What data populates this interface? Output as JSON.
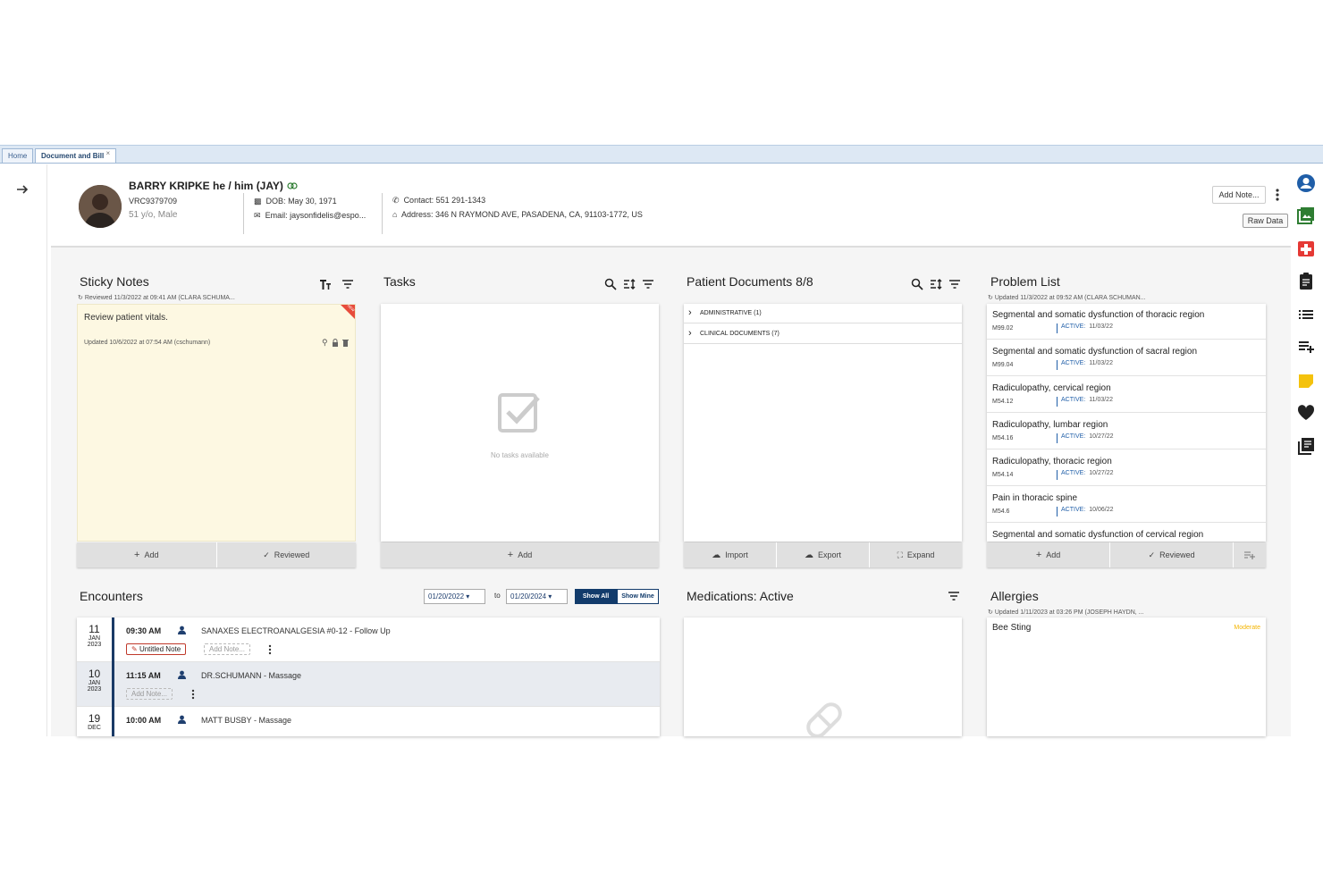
{
  "tabs": [
    {
      "label": "Home"
    },
    {
      "label": "Document and Bill"
    }
  ],
  "tab_close": "×",
  "patient": {
    "name": "BARRY KRIPKE he / him (JAY)",
    "id": "VRC9379709",
    "age_sex": "51 y/o, Male",
    "dob_label": "DOB:",
    "dob": "May 30, 1971",
    "email_label": "Email:",
    "email": "jaysonfidelis@espo...",
    "contact_label": "Contact:",
    "contact": "551 291-1343",
    "address_label": "Address:",
    "address": "346 N RAYMOND AVE, PASADENA, CA, 91103-1772, US"
  },
  "header_actions": {
    "add_note": "Add Note...",
    "raw_data": "Raw Data"
  },
  "sticky_notes": {
    "title": "Sticky Notes",
    "reviewed": "Reviewed 11/3/2022 at 09:41 AM (CLARA SCHUMA...",
    "note_text": "Review patient vitals.",
    "note_updated": "Updated 10/6/2022 at 07:54 AM (cschumann)",
    "corner_tag": "NEW",
    "add": "Add",
    "reviewed_btn": "Reviewed"
  },
  "tasks": {
    "title": "Tasks",
    "empty": "No tasks available",
    "add": "Add"
  },
  "patient_documents": {
    "title": "Patient Documents 8/8",
    "folders": [
      {
        "label": "ADMINISTRATIVE (1)"
      },
      {
        "label": "CLINICAL DOCUMENTS (7)"
      }
    ],
    "import": "Import",
    "export": "Export",
    "expand": "Expand"
  },
  "problem_list": {
    "title": "Problem List",
    "updated": "Updated 11/3/2022 at 09:52 AM (CLARA SCHUMAN...",
    "status_label": "ACTIVE:",
    "items": [
      {
        "title": "Segmental and somatic dysfunction of thoracic region",
        "code": "M99.02",
        "date": "11/03/22"
      },
      {
        "title": "Segmental and somatic dysfunction of sacral region",
        "code": "M99.04",
        "date": "11/03/22"
      },
      {
        "title": "Radiculopathy, cervical region",
        "code": "M54.12",
        "date": "11/03/22"
      },
      {
        "title": "Radiculopathy, lumbar region",
        "code": "M54.16",
        "date": "10/27/22"
      },
      {
        "title": "Radiculopathy, thoracic region",
        "code": "M54.14",
        "date": "10/27/22"
      },
      {
        "title": "Pain in thoracic spine",
        "code": "M54.6",
        "date": "10/06/22"
      },
      {
        "title": "Segmental and somatic dysfunction of cervical region"
      }
    ],
    "add": "Add",
    "reviewed_btn": "Reviewed"
  },
  "encounters": {
    "title": "Encounters",
    "date_from": "01/20/2022",
    "to_label": "to",
    "date_to": "01/20/2024",
    "show_all": "Show All",
    "show_mine": "Show Mine",
    "rows": [
      {
        "day": "11",
        "month": "JAN",
        "year": "2023",
        "time": "09:30 AM",
        "provider": "SANAXES ELECTROANALGESIA #0-12  -   Follow Up",
        "note": "Untitled Note",
        "add_note": "Add Note..."
      },
      {
        "day": "10",
        "month": "JAN",
        "year": "2023",
        "time": "11:15 AM",
        "provider": "DR.SCHUMANN  -   Massage",
        "add_note": "Add Note..."
      },
      {
        "day": "19",
        "month": "DEC",
        "time": "10:00 AM",
        "provider": "MATT BUSBY  -   Massage"
      }
    ]
  },
  "medications": {
    "title": "Medications: Active"
  },
  "allergies": {
    "title": "Allergies",
    "updated": "Updated 1/11/2023 at 03:26 PM (JOSEPH HAYDN, ...",
    "items": [
      {
        "name": "Bee Sting",
        "severity": "Moderate"
      }
    ]
  },
  "colors": {
    "accent": "#1f5ea8",
    "navy": "#123b6b",
    "sticky": "#fdf8e2",
    "green": "#2e7d32",
    "red": "#e53935",
    "yellow": "#f4c20d"
  }
}
